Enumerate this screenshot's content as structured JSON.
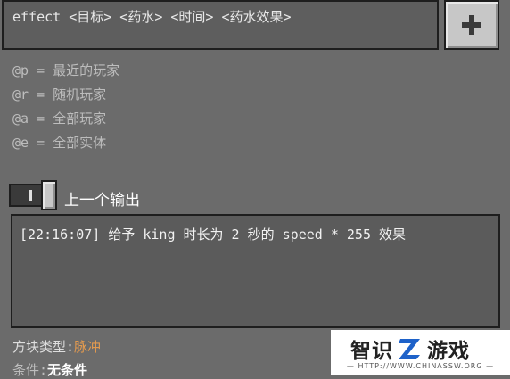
{
  "command_input": {
    "value": "effect <目标> <药水> <时间> <药水效果>"
  },
  "add_button": {
    "icon": "plus-icon"
  },
  "selector_hints": [
    "@p = 最近的玩家",
    "@r = 随机玩家",
    "@a = 全部玩家",
    "@e = 全部实体"
  ],
  "previous_output_toggle": {
    "label": "上一个输出",
    "state": "on"
  },
  "output_log": {
    "text": "[22:16:07] 给予 king 时长为 2 秒的 speed * 255 效果"
  },
  "block_type": {
    "label": "方块类型:",
    "value": "脉冲"
  },
  "condition": {
    "label": "条件:",
    "value": "无条件"
  },
  "watermark": {
    "brand_left": "智识",
    "brand_logo": "Z",
    "brand_right": "游戏",
    "url": "— HTTP://WWW.CHINASSW.ORG —"
  },
  "colors": {
    "background": "#6b6b6b",
    "block_type_value": "#e39a4f"
  }
}
